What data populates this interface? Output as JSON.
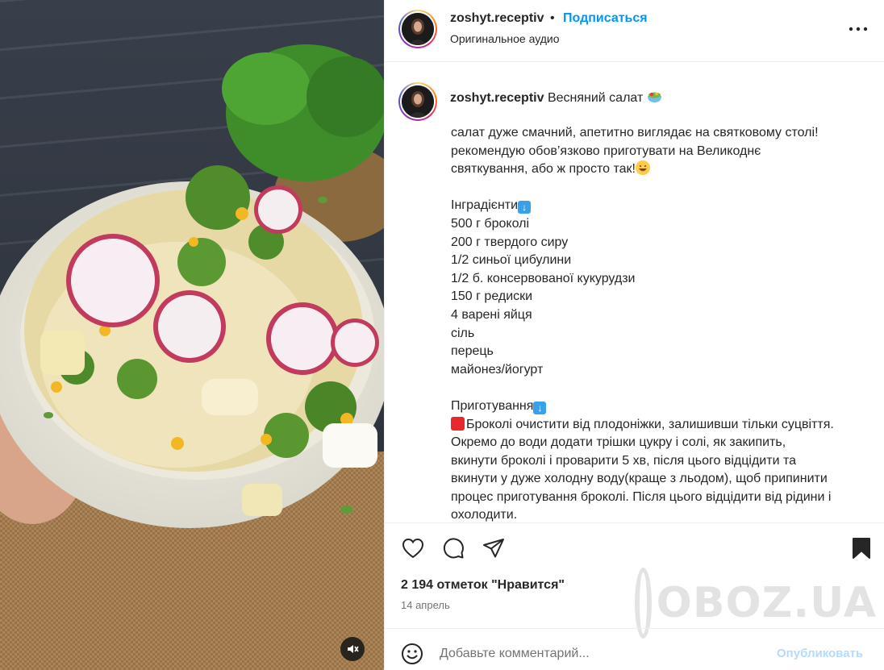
{
  "header": {
    "username": "zoshyt.receptiv",
    "separator": "•",
    "follow_label": "Подписаться",
    "audio_label": "Оригинальное аудио",
    "more_icon": "more-horizontal-icon"
  },
  "caption": {
    "username": "zoshyt.receptiv",
    "title": "Весняний салат",
    "intro": [
      "салат дуже смачний, апетитно виглядає на святковому столі!",
      "рекомендую обов’язково приготувати на Великоднє"
    ],
    "intro_last": "святкування, або ж просто так!",
    "ingredients_heading": "Інградієнти",
    "ingredients": [
      "500 г броколі",
      "200 г твердого сиру",
      "1/2 синьої цибулини",
      "1/2 б. консервованої кукурудзи",
      "150 г редиски",
      "4 варені яйця",
      "сіль",
      "перець",
      "майонез/йогурт"
    ],
    "method_heading": "Приготування",
    "method_first": "Броколі очистити від плодоніжки, залишивши тільки суцвіття.",
    "method_rest": [
      "Окремо до води додати трішки цукру і солі, як закипить,",
      "вкинути броколі і проварити 5 хв, після цього відцідити та",
      "вкинути у дуже холодну воду(краще з льодом), щоб припинити",
      "процес приготування броколі. Після цього відцідити від рідини і",
      "охолодити."
    ]
  },
  "actions": {
    "like_icon": "heart-icon",
    "comment_icon": "comment-icon",
    "share_icon": "share-icon",
    "save_icon": "bookmark-icon"
  },
  "likes_text": "2 194 отметок \"Нравится\"",
  "date_text": "14 апрель",
  "comment": {
    "placeholder": "Добавьте комментарий...",
    "publish_label": "Опубликовать"
  },
  "watermark_text": "OBOZ.UA",
  "colors": {
    "accent": "#0095f6",
    "publish_disabled": "#b3dbff",
    "text": "#262626",
    "secondary": "#737373"
  }
}
